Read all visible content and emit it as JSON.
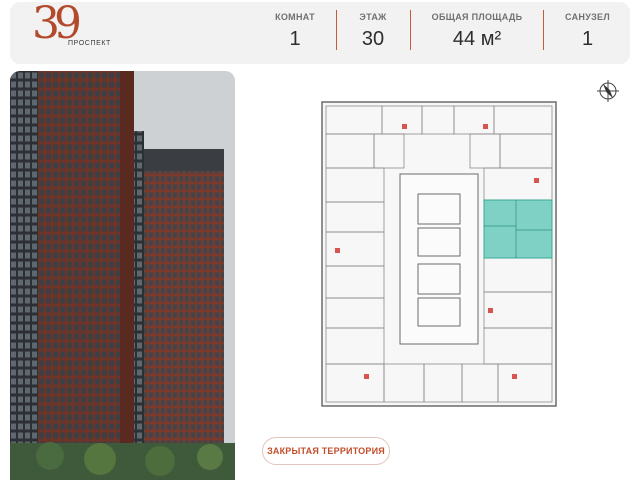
{
  "logo": {
    "number": "39",
    "subtitle": "ПРОСПЕКТ"
  },
  "stats": [
    {
      "label": "КОМНАТ",
      "value": "1"
    },
    {
      "label": "ЭТАЖ",
      "value": "30"
    },
    {
      "label": "ОБЩАЯ ПЛОЩАДЬ",
      "value": "44 м²"
    },
    {
      "label": "САНУЗЕЛ",
      "value": "1"
    }
  ],
  "territory_button": {
    "label": "ЗАКРЫТАЯ ТЕРРИТОРИЯ"
  },
  "icons": {
    "compass": "compass-icon"
  },
  "colors": {
    "accent": "#c24e2a",
    "selected_unit": "#7fd0c5",
    "brick": "#7a3b2c"
  }
}
